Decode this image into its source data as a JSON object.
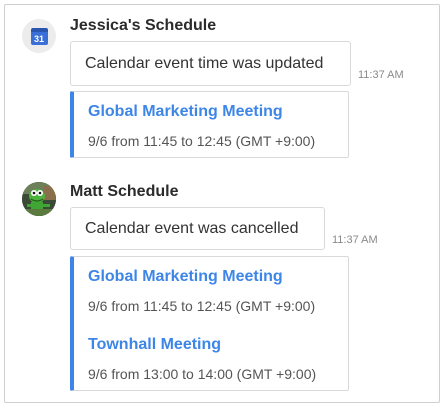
{
  "messages": [
    {
      "sender": "Jessica's Schedule",
      "avatar_icon": "calendar-icon",
      "avatar_text": "31",
      "text": "Calendar event time was updated",
      "time": "11:37 AM",
      "events": [
        {
          "title": "Global Marketing Meeting",
          "when": "9/6 from 11:45 to 12:45 (GMT +9:00)"
        }
      ]
    },
    {
      "sender": "Matt Schedule",
      "avatar_icon": "user-avatar-photo",
      "text": "Calendar event was cancelled",
      "time": "11:37 AM",
      "events": [
        {
          "title": "Global Marketing Meeting",
          "when": "9/6 from 11:45 to 12:45 (GMT +9:00)"
        },
        {
          "title": "Townhall Meeting",
          "when": "9/6 from 13:00 to 14:00 (GMT +9:00)"
        }
      ]
    }
  ],
  "colors": {
    "accent": "#3d86e8",
    "calendar_icon": "#3a6fd8"
  }
}
